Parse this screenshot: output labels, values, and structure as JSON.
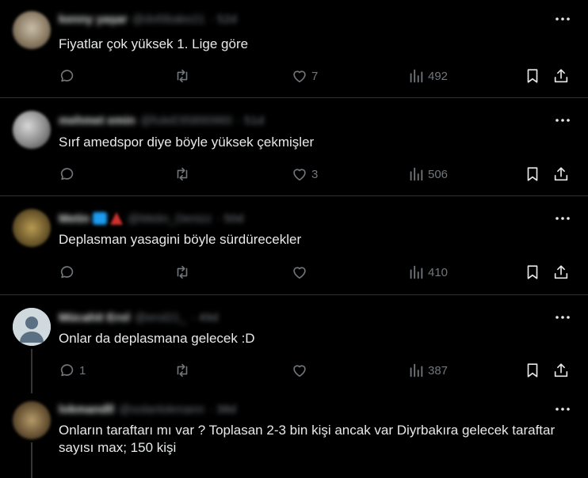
{
  "tweets": [
    {
      "name": "kenny yaşar",
      "handle": "@dvl0bake21",
      "time": "52d",
      "text": "Fiyatlar çok yüksek 1. Lige göre",
      "replies": "",
      "likes": "7",
      "views": "492"
    },
    {
      "name": "mehmet emin",
      "handle": "@fuleE95890960",
      "time": "51d",
      "text": "Sırf amedspor diye böyle yüksek çekmişler",
      "replies": "",
      "likes": "3",
      "views": "506"
    },
    {
      "name": "Metin",
      "handle": "@Metin_Denizz",
      "time": "50d",
      "text": "Deplasman yasagini böyle sürdürecekler",
      "replies": "",
      "likes": "",
      "views": "410"
    },
    {
      "name": "Mücahit Erol",
      "handle": "@erol21_",
      "time": "49d",
      "text": "Onlar da deplasmana gelecek :D",
      "replies": "1",
      "likes": "",
      "views": "387"
    },
    {
      "name": "lokmandll",
      "handle": "@solanlokmann",
      "time": "38d",
      "text": "Onların taraftarı mı var ? Toplasan 2-3 bin kişi ancak var Diyrbakıra gelecek taraftar sayısı max; 150 kişi",
      "replies": "",
      "likes": "",
      "views": ""
    }
  ],
  "colors": {
    "background": "#000000",
    "text": "#e7e9ea",
    "muted": "#71767b",
    "divider": "#2f3336"
  },
  "icons": [
    "reply-icon",
    "retweet-icon",
    "heart-icon",
    "views-icon",
    "bookmark-icon",
    "share-icon",
    "more-icon"
  ]
}
